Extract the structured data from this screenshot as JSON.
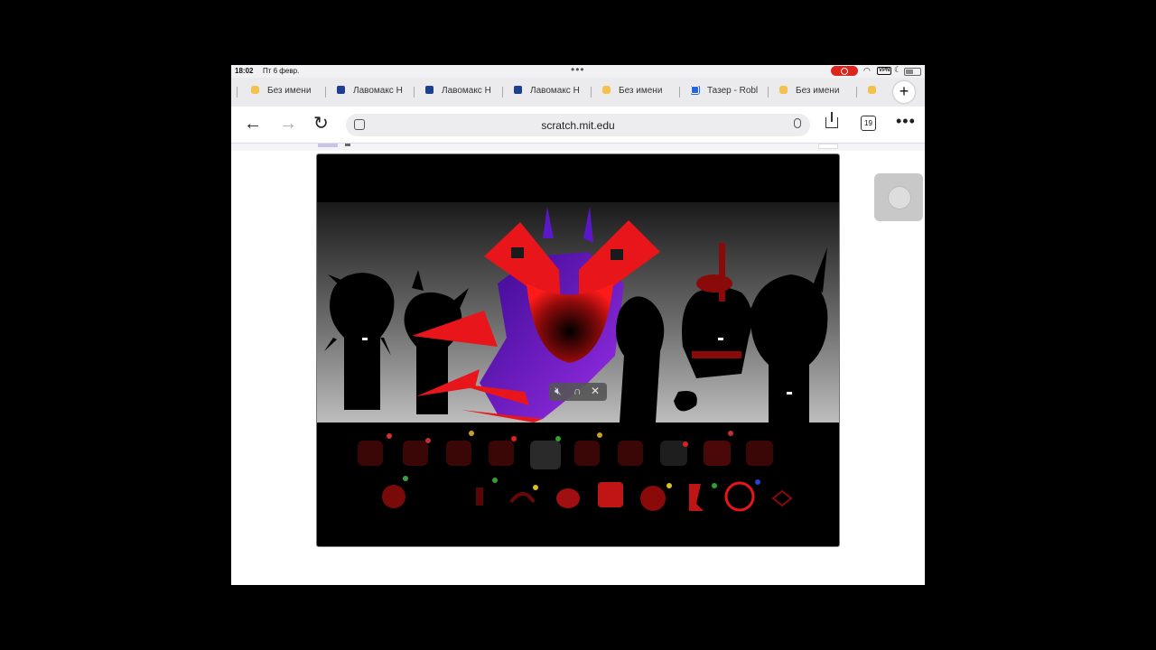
{
  "status_bar": {
    "time": "18:02",
    "date": "Пт 6 февр.",
    "multitask_dots": "•••",
    "vpn": "VPN"
  },
  "tabs": [
    {
      "label": "Без имени",
      "favicon": "yellow-doc-icon"
    },
    {
      "label": "Лавомакс Н",
      "favicon": "scratch-project-icon"
    },
    {
      "label": "Лавомакс Н",
      "favicon": "scratch-project-icon"
    },
    {
      "label": "Лавомакс Н",
      "favicon": "scratch-project-icon"
    },
    {
      "label": "Без имени",
      "favicon": "yellow-doc-icon"
    },
    {
      "label": "Тазер - Robl",
      "favicon": "roblox-icon"
    },
    {
      "label": "Без имени",
      "favicon": "yellow-doc-icon"
    }
  ],
  "toolbar": {
    "url": "scratch.mit.edu",
    "tab_count": "19",
    "new_tab": "+",
    "more": "•••"
  },
  "stage": {
    "colors": {
      "background": "#000000",
      "accent_red": "#e8151a",
      "purple": "#7a1ed8"
    }
  }
}
